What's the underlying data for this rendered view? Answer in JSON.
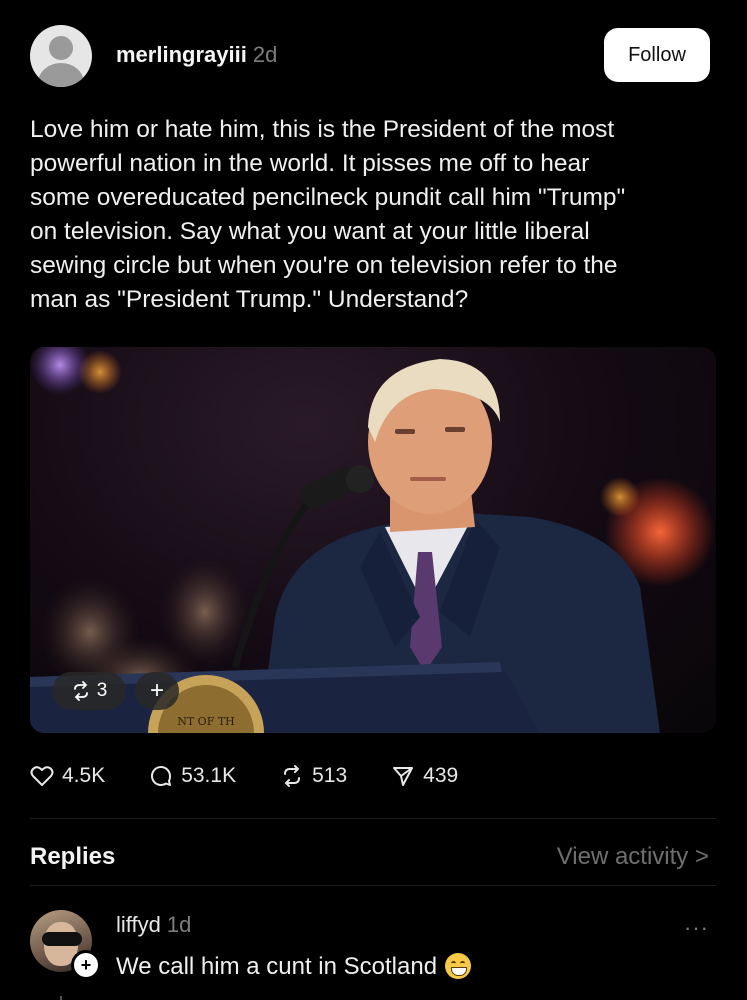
{
  "post": {
    "author": "merlingrayiii",
    "time": "2d",
    "follow_label": "Follow",
    "text": "Love him or hate him, this is the President of the most\npowerful nation in the world. It pisses me off to hear\nsome overeducated pencilneck pundit call him \"Trump\"\non television.  Say what you want at your little liberal\nsewing circle but when you're on television refer to the\nman as \"President Trump.\" Understand?",
    "media": {
      "repost_count": "3",
      "plus_label": "+",
      "podium_seal_text": "NT OF TH"
    },
    "stats": {
      "likes": "4.5K",
      "comments": "53.1K",
      "reposts": "513",
      "shares": "439"
    }
  },
  "replies_section": {
    "title": "Replies",
    "view_activity": "View activity >"
  },
  "reply": {
    "author": "liffyd",
    "time": "1d",
    "text": "We call him a cunt in Scotland",
    "more_label": "···"
  },
  "colors": {
    "background": "#000000",
    "text": "#f0f0f0",
    "muted": "#7d7d7d",
    "button_bg": "#ffffff"
  }
}
